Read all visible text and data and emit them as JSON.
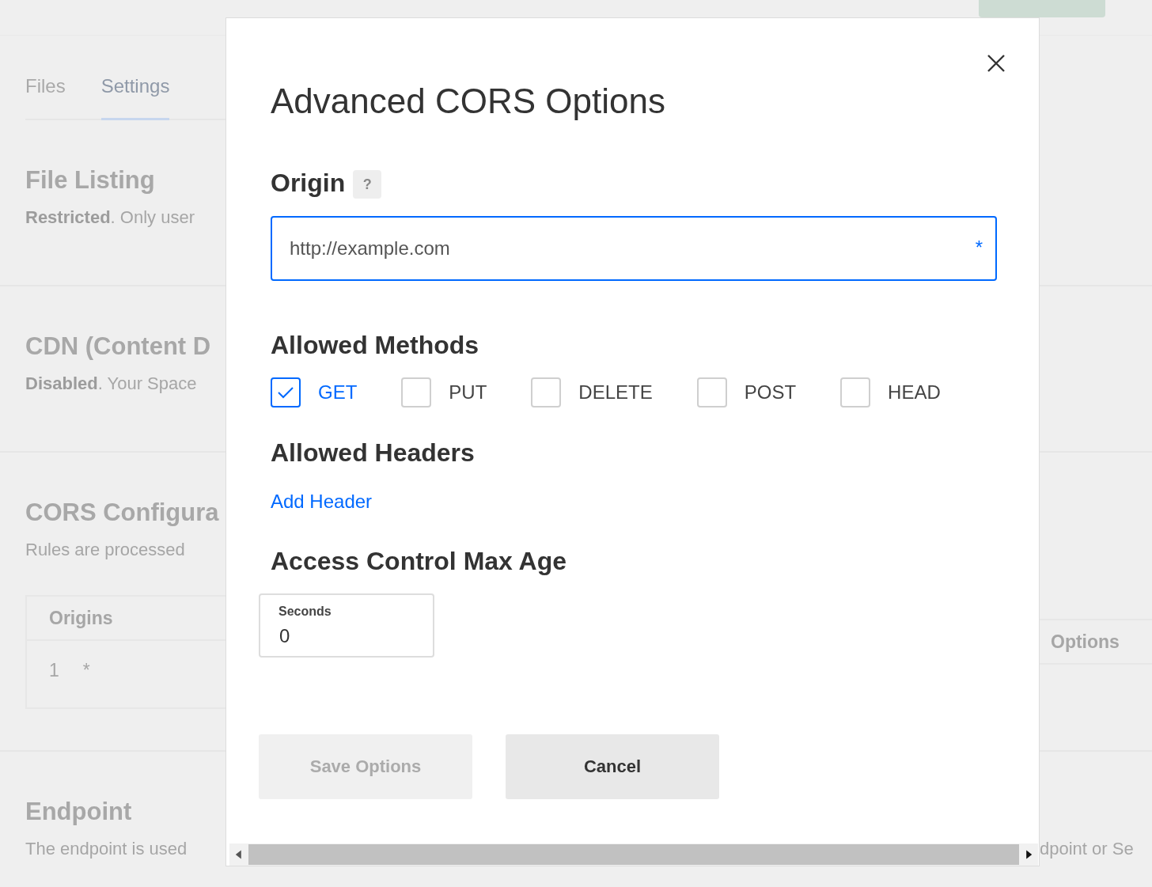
{
  "background": {
    "tabs": [
      {
        "label": "Files",
        "selected": false
      },
      {
        "label": "Settings",
        "selected": true
      }
    ],
    "sections": [
      {
        "kind": "text",
        "title": "File Listing",
        "text": "**Restricted**. Only user"
      },
      {
        "kind": "text",
        "title": "CDN (Content D",
        "text": "**Disabled**. Your Space"
      },
      {
        "kind": "table",
        "title": "CORS Configura",
        "text": "Rules are processed",
        "table": {
          "columns": [
            "Origins",
            "Options"
          ],
          "rows": [
            {
              "line": "1",
              "cells": [
                "*"
              ]
            }
          ]
        }
      },
      {
        "kind": "text",
        "title": "Endpoint",
        "text": "The endpoint is used",
        "text_right": "dpoint or Se"
      }
    ]
  },
  "modal": {
    "title": "Advanced CORS Options",
    "origin": {
      "label": "Origin",
      "help": "?",
      "placeholder": "http://example.com",
      "required_mark": "*"
    },
    "methods": {
      "label": "Allowed Methods",
      "items": [
        {
          "label": "GET",
          "checked": true
        },
        {
          "label": "PUT",
          "checked": false
        },
        {
          "label": "DELETE",
          "checked": false
        },
        {
          "label": "POST",
          "checked": false
        },
        {
          "label": "HEAD",
          "checked": false
        }
      ]
    },
    "headers": {
      "label": "Allowed Headers",
      "link": "Add Header"
    },
    "max_age": {
      "label": "Access Control Max Age",
      "field_label": "Seconds",
      "value": "0"
    },
    "buttons": [
      {
        "label": "Save Options",
        "disabled": true
      },
      {
        "label": "Cancel",
        "disabled": false
      }
    ]
  }
}
